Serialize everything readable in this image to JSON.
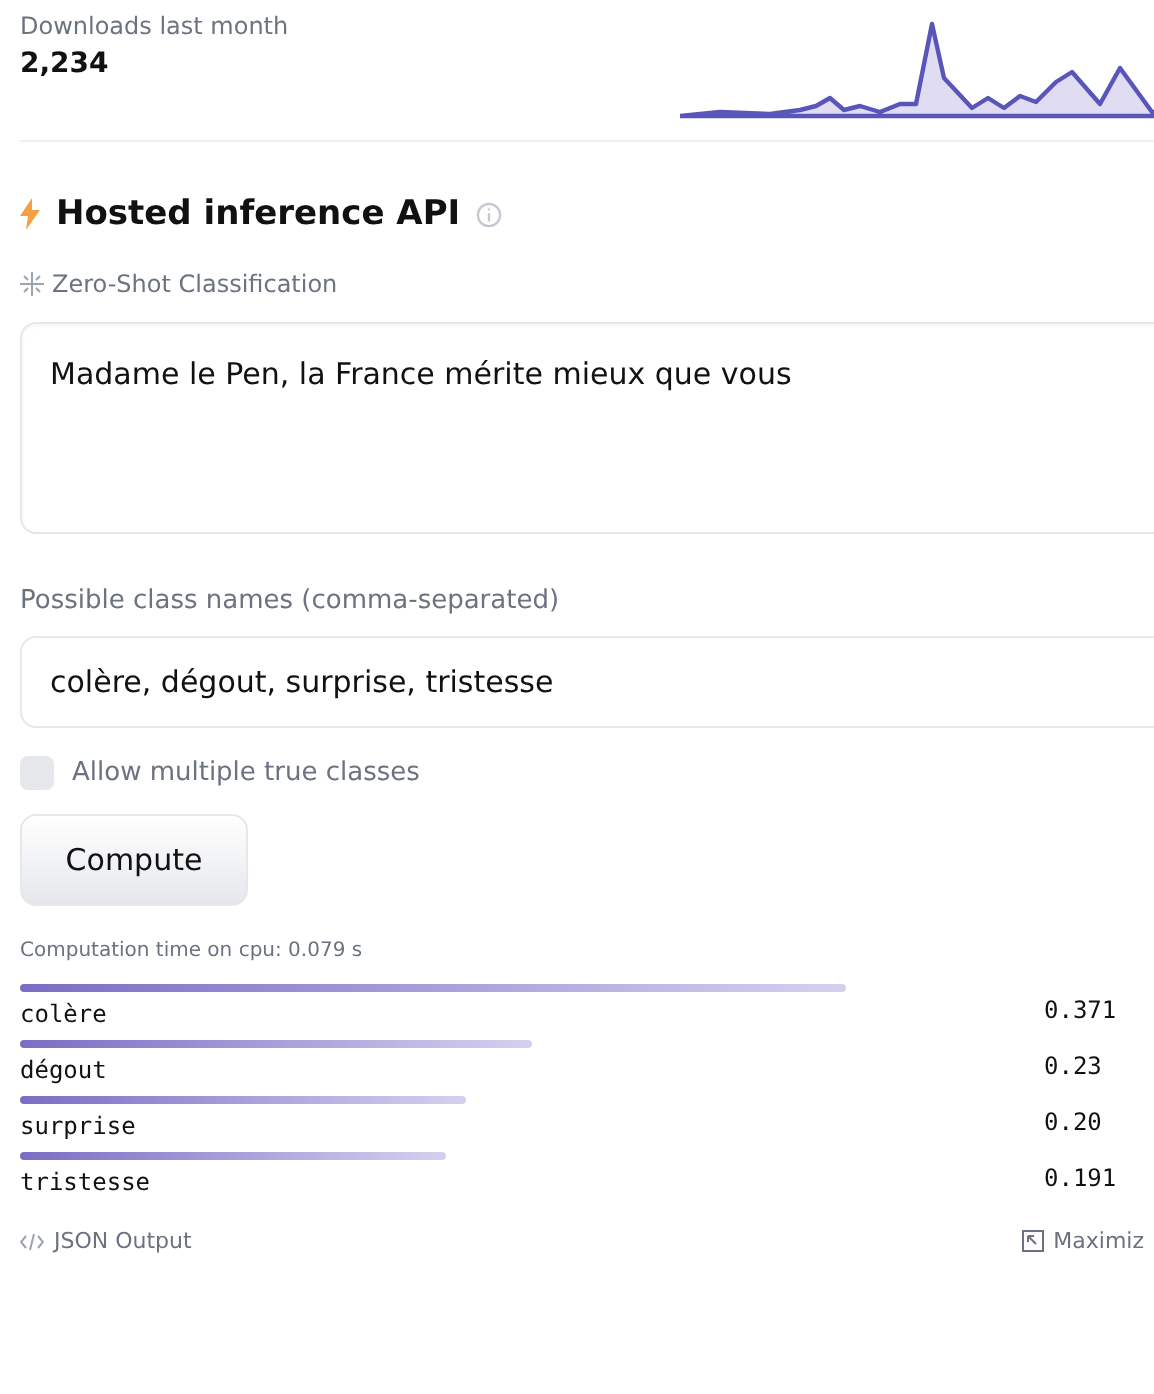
{
  "downloads": {
    "label": "Downloads last month",
    "count": "2,234"
  },
  "inference": {
    "title": "Hosted inference API",
    "task": "Zero-Shot Classification"
  },
  "input_text": {
    "value": "Madame le Pen, la France mérite mieux que vous"
  },
  "class_names": {
    "label": "Possible class names (comma-separated)",
    "value": "colère, dégout, surprise, tristesse"
  },
  "multi_label": {
    "label": "Allow multiple true classes",
    "checked": false
  },
  "compute_button": "Compute",
  "computation_time": "Computation time on cpu: 0.079 s",
  "results": [
    {
      "label": "colère",
      "score": "0.371"
    },
    {
      "label": "dégout",
      "score": "0.23"
    },
    {
      "label": "surprise",
      "score": "0.20"
    },
    {
      "label": "tristesse",
      "score": "0.191"
    }
  ],
  "footer": {
    "json_output": "JSON Output",
    "maximize": "Maximiz"
  }
}
